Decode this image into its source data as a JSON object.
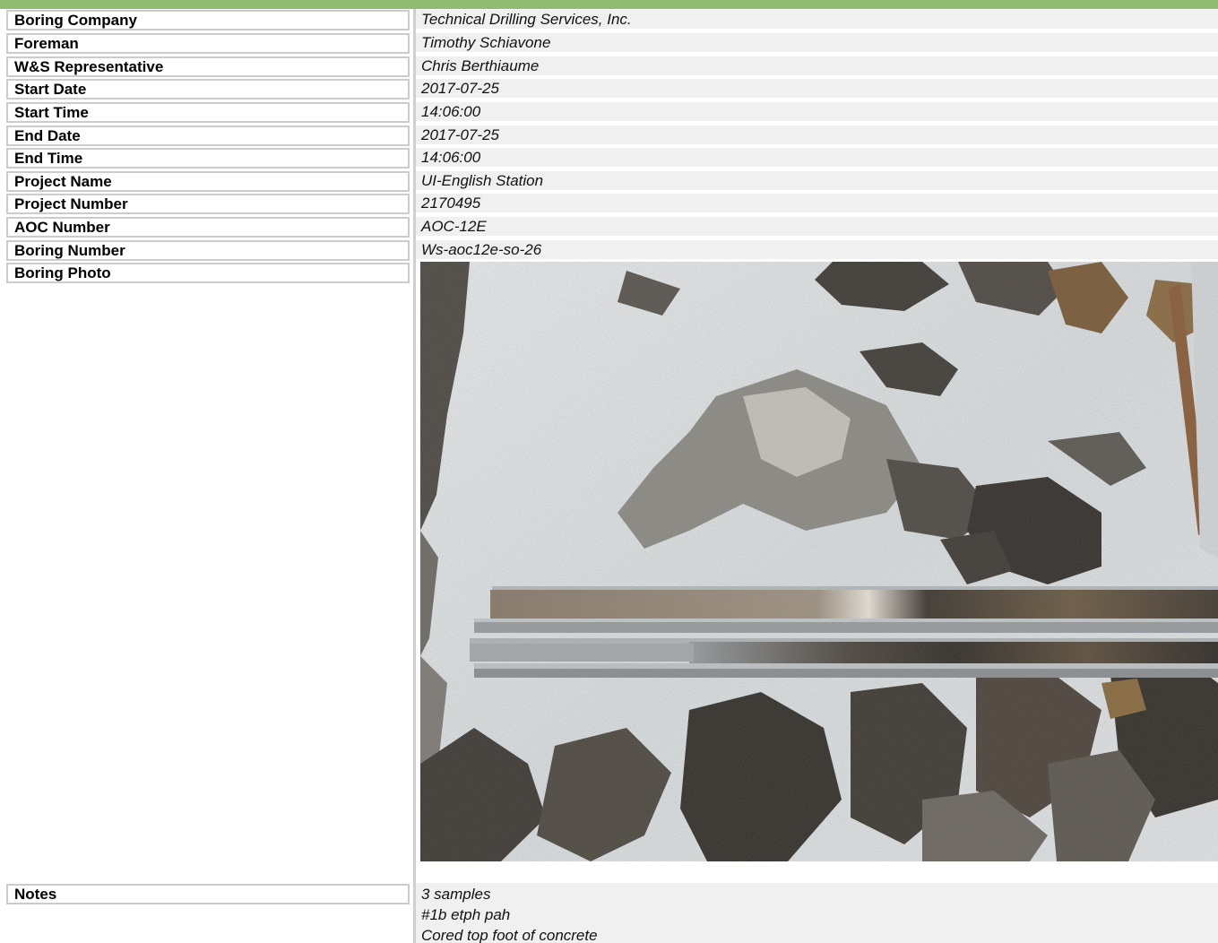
{
  "rows": [
    {
      "label": "Boring Company",
      "value": "Technical Drilling Services, Inc."
    },
    {
      "label": "Foreman",
      "value": "Timothy Schiavone"
    },
    {
      "label": "W&S Representative",
      "value": "Chris Berthiaume"
    },
    {
      "label": "Start Date",
      "value": "2017-07-25"
    },
    {
      "label": "Start Time",
      "value": "14:06:00"
    },
    {
      "label": "End Date",
      "value": "2017-07-25"
    },
    {
      "label": "End Time",
      "value": "14:06:00"
    },
    {
      "label": "Project Name",
      "value": "UI-English Station"
    },
    {
      "label": "Project Number",
      "value": "2170495"
    },
    {
      "label": "AOC Number",
      "value": "AOC-12E"
    },
    {
      "label": "Boring Number",
      "value": "Ws-aoc12e-so-26"
    }
  ],
  "photo": {
    "label": "Boring Photo"
  },
  "notes": {
    "label": "Notes",
    "lines": [
      "3 samples",
      "#1b etph pah",
      "Cored top foot of concrete"
    ]
  },
  "colors": {
    "header_bar": "#8fbc6f",
    "label_border": "#cccccc",
    "value_background": "#f0f0f0"
  }
}
